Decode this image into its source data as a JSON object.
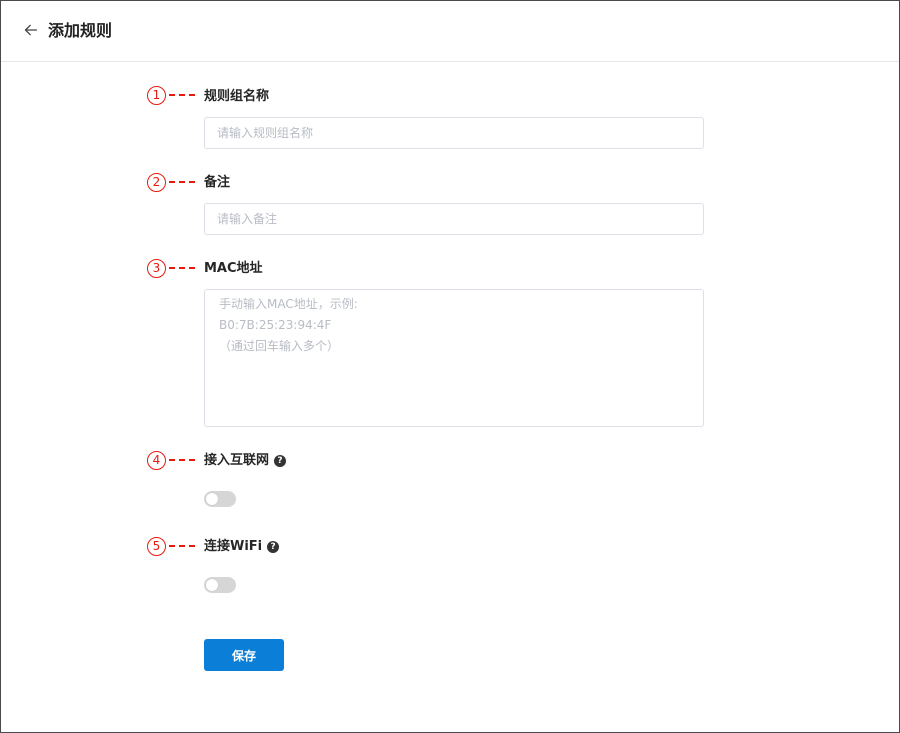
{
  "header": {
    "back_icon": "arrow-left-icon",
    "title": "添加规则"
  },
  "colors": {
    "primary": "#0b7ed8",
    "annotation": "#e8190f",
    "toggle_off": "#d6d6d6",
    "border": "#dcdfe6"
  },
  "form": {
    "markers": [
      "1",
      "2",
      "3",
      "4",
      "5"
    ],
    "group_name": {
      "label": "规则组名称",
      "value": "",
      "placeholder": "请输入规则组名称"
    },
    "remark": {
      "label": "备注",
      "value": "",
      "placeholder": "请输入备注"
    },
    "mac": {
      "label": "MAC地址",
      "value": "",
      "placeholder": "手动输入MAC地址，示例:\nB0:7B:25:23:94:4F\n（通过回车输入多个）"
    },
    "internet": {
      "label": "接入互联网",
      "help_icon": "question-circle-icon",
      "enabled": false
    },
    "wifi": {
      "label": "连接WiFi",
      "help_icon": "question-circle-icon",
      "enabled": false
    },
    "save_label": "保存"
  }
}
